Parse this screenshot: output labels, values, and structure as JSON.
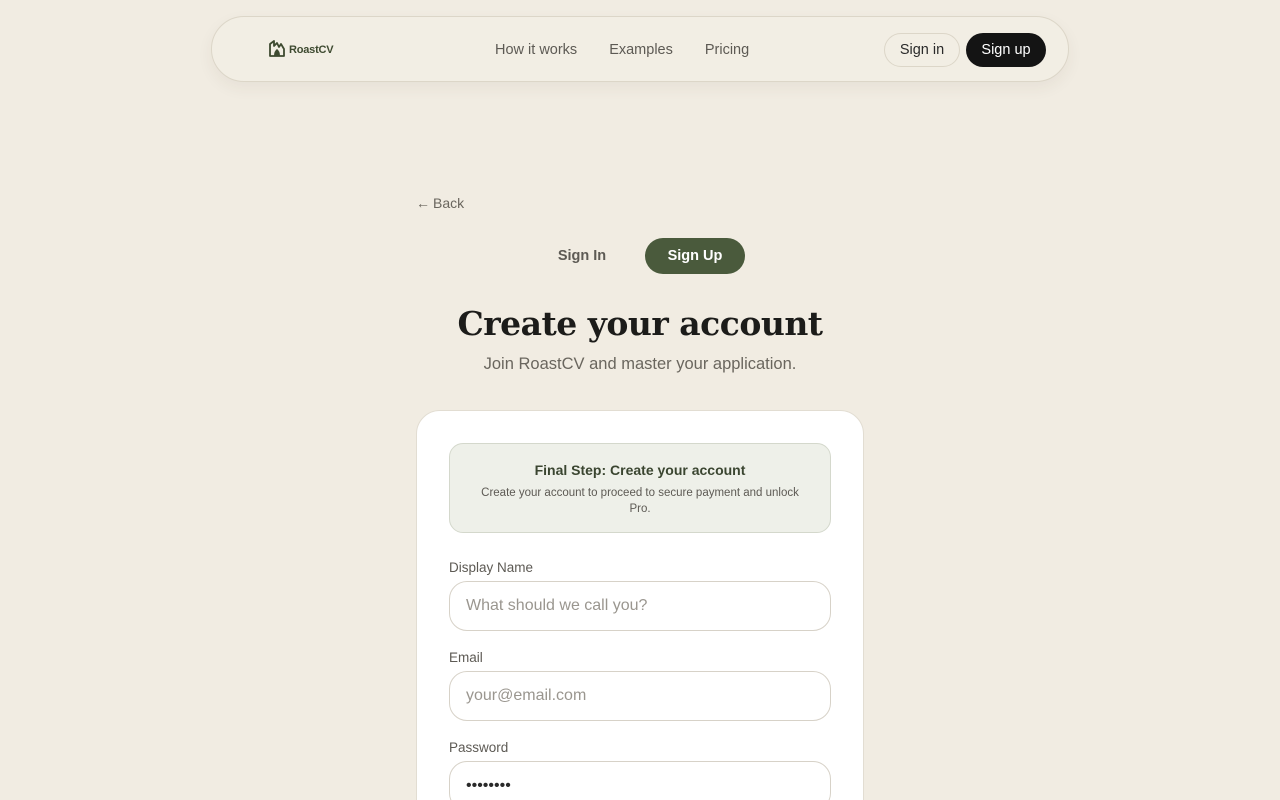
{
  "nav": {
    "logo_text": "RoastCV",
    "links": [
      "How it works",
      "Examples",
      "Pricing"
    ],
    "signin_label": "Sign in",
    "signup_label": "Sign up"
  },
  "back": {
    "arrow": "←",
    "label": "Back"
  },
  "auth_toggle": {
    "signin_label": "Sign In",
    "signup_label": "Sign Up",
    "active": "Sign Up"
  },
  "heading": {
    "title": "Create your account",
    "subtitle": "Join RoastCV and master your application."
  },
  "notice": {
    "title": "Final Step: Create your account",
    "text": "Create your account to proceed to secure payment and unlock Pro."
  },
  "form": {
    "display_name": {
      "label": "Display Name",
      "placeholder": "What should we call you?",
      "value": ""
    },
    "email": {
      "label": "Email",
      "placeholder": "your@email.com",
      "value": ""
    },
    "password": {
      "label": "Password",
      "value": "12345678"
    }
  },
  "colors": {
    "background": "#f1ece2",
    "accent_green": "#4a5a3c",
    "dark_button": "#141414",
    "card": "#ffffff"
  },
  "icons": {
    "logo": "flame-document-icon"
  }
}
